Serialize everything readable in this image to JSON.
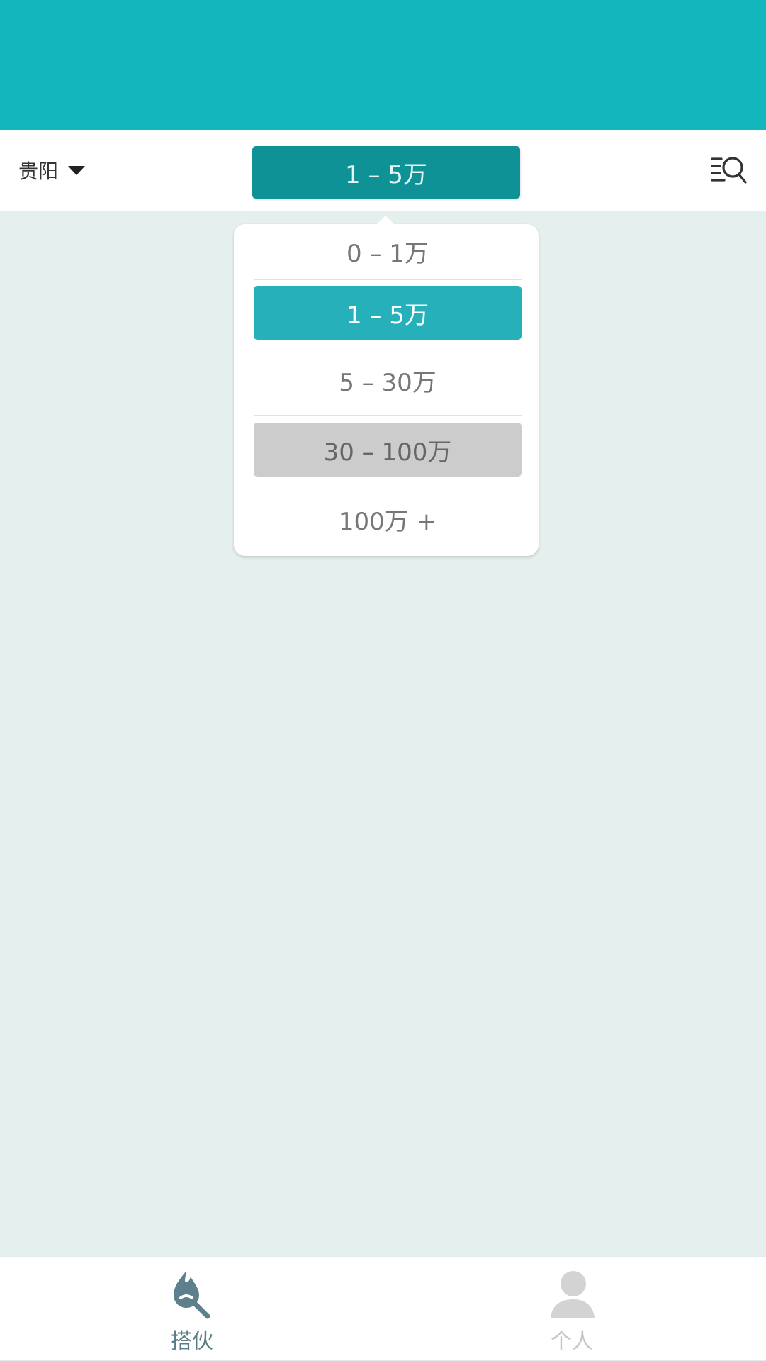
{
  "header": {
    "background_color": "#12b6bd"
  },
  "filter_bar": {
    "city_label": "贵阳",
    "range_label": "1 – 5万",
    "search_icon": "list-search-icon"
  },
  "dropdown": {
    "options": [
      {
        "label": "0 – 1万",
        "state": "normal"
      },
      {
        "label": "1 – 5万",
        "state": "selected"
      },
      {
        "label": "5 – 30万",
        "state": "normal"
      },
      {
        "label": "30 – 100万",
        "state": "hover"
      },
      {
        "label": "100万 +",
        "state": "normal"
      }
    ],
    "selected_color": "#26b1ba",
    "hover_color": "#cccccc"
  },
  "tabbar": {
    "tabs": [
      {
        "label": "搭伙",
        "icon": "match-search-icon",
        "active": true
      },
      {
        "label": "个人",
        "icon": "person-icon",
        "active": false
      }
    ]
  },
  "colors": {
    "accent": "#12b6bd",
    "button": "#0f9296",
    "content_bg": "#e5efee"
  }
}
